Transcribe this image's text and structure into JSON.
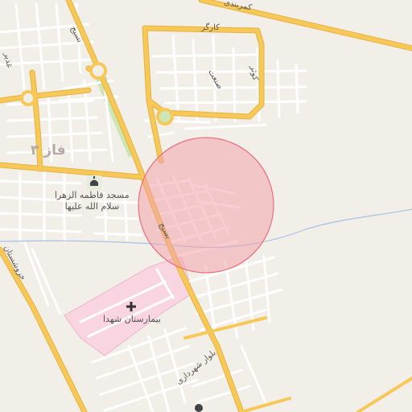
{
  "map": {
    "streets": {
      "kamarbandi": "کمربندی",
      "kargar": "کارگر",
      "sanat": "صنعت",
      "kowsar": "کوثر",
      "ghadir": "غدیر",
      "basij_north": "بسیج",
      "basij_south": "بسیج",
      "khoroushestan": "خروشستان",
      "shahrdari": "بلوار شهرداری"
    },
    "district": {
      "label": "فاز ۳"
    },
    "poi": {
      "mosque_line1": "مسجد فاطمه الزهرا",
      "mosque_line2": "سلام الله علیها",
      "mosque_icon": "mosque-icon",
      "hospital": "بیمارستان شهدا",
      "hospital_icon": "hospital-cross-icon",
      "bottom_icon": "poi-icon"
    },
    "colors": {
      "background": "#f2efe9",
      "major_road": "#f7c858",
      "minor_road": "#ffffff",
      "hospital_area": "#f9d5e1",
      "green_strip": "#cce6b5",
      "river": "#a5c1e6",
      "circle_fill": "#f3a3ac",
      "circle_stroke": "#e8707c"
    }
  }
}
